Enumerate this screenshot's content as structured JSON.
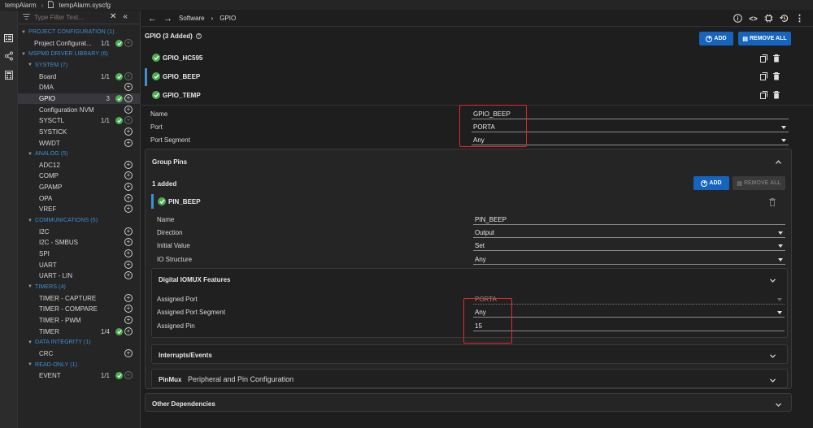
{
  "titlebar": {
    "project": "tempAlarm",
    "file": "tempAlarm.syscfg"
  },
  "sidebar": {
    "filter_placeholder": "Type Filter Text...",
    "rows": [
      {
        "kind": "cat",
        "label": "PROJECT CONFIGURATION (1)"
      },
      {
        "kind": "item",
        "label": "Project Configurat...",
        "count": "1/1",
        "ok": true,
        "plus": "dim"
      },
      {
        "kind": "cat",
        "label": "MSPM0 DRIVER LIBRARY (6)"
      },
      {
        "kind": "cat",
        "label": "SYSTEM (7)",
        "sub": true
      },
      {
        "kind": "item",
        "label": "Board",
        "count": "1/1",
        "ok": true,
        "plus": "dim"
      },
      {
        "kind": "item",
        "label": "DMA",
        "plus": "on"
      },
      {
        "kind": "item",
        "label": "GPIO",
        "count": "3",
        "ok": true,
        "plus": "on",
        "selected": true
      },
      {
        "kind": "item",
        "label": "Configuration NVM",
        "plus": "on"
      },
      {
        "kind": "item",
        "label": "SYSCTL",
        "count": "1/1",
        "ok": true,
        "plus": "dim"
      },
      {
        "kind": "item",
        "label": "SYSTICK",
        "plus": "on"
      },
      {
        "kind": "item",
        "label": "WWDT",
        "plus": "on"
      },
      {
        "kind": "cat",
        "label": "ANALOG (5)",
        "sub": true
      },
      {
        "kind": "item",
        "label": "ADC12",
        "plus": "on"
      },
      {
        "kind": "item",
        "label": "COMP",
        "plus": "on"
      },
      {
        "kind": "item",
        "label": "GPAMP",
        "plus": "on"
      },
      {
        "kind": "item",
        "label": "OPA",
        "plus": "on"
      },
      {
        "kind": "item",
        "label": "VREF",
        "plus": "on"
      },
      {
        "kind": "cat",
        "label": "COMMUNICATIONS (5)",
        "sub": true
      },
      {
        "kind": "item",
        "label": "I2C",
        "plus": "on"
      },
      {
        "kind": "item",
        "label": "I2C - SMBUS",
        "plus": "on"
      },
      {
        "kind": "item",
        "label": "SPI",
        "plus": "on"
      },
      {
        "kind": "item",
        "label": "UART",
        "plus": "on"
      },
      {
        "kind": "item",
        "label": "UART - LIN",
        "plus": "on"
      },
      {
        "kind": "cat",
        "label": "TIMERS (4)",
        "sub": true
      },
      {
        "kind": "item",
        "label": "TIMER - CAPTURE",
        "plus": "on"
      },
      {
        "kind": "item",
        "label": "TIMER - COMPARE",
        "plus": "on"
      },
      {
        "kind": "item",
        "label": "TIMER - PWM",
        "plus": "on"
      },
      {
        "kind": "item",
        "label": "TIMER",
        "count": "1/4",
        "ok": true,
        "plus": "on"
      },
      {
        "kind": "cat",
        "label": "DATA INTEGRITY (1)",
        "sub": true
      },
      {
        "kind": "item",
        "label": "CRC",
        "plus": "on"
      },
      {
        "kind": "cat",
        "label": "READ-ONLY (1)",
        "sub": true
      },
      {
        "kind": "item",
        "label": "EVENT",
        "count": "1/1",
        "ok": true,
        "plus": "dim"
      }
    ]
  },
  "topbar": {
    "crumb_software": "Software",
    "crumb_gpio": "GPIO"
  },
  "main": {
    "header": "GPIO (3 Added)",
    "add_label": "ADD",
    "remove_all_label": "REMOVE ALL",
    "instances": [
      "GPIO_HC595",
      "GPIO_BEEP",
      "GPIO_TEMP"
    ],
    "props": {
      "name_label": "Name",
      "name_value": "GPIO_BEEP",
      "port_label": "Port",
      "port_value": "PORTA",
      "seg_label": "Port Segment",
      "seg_value": "Any"
    },
    "group_pins": {
      "title": "Group Pins",
      "added": "1 added",
      "add_label": "ADD",
      "remove_all_label": "REMOVE ALL",
      "pin_name": "PIN_BEEP",
      "props": {
        "name_label": "Name",
        "name_value": "PIN_BEEP",
        "dir_label": "Direction",
        "dir_value": "Output",
        "init_label": "Initial Value",
        "init_value": "Set",
        "io_label": "IO Structure",
        "io_value": "Any"
      },
      "iomux": {
        "title": "Digital IOMUX Features",
        "port_label": "Assigned Port",
        "port_value": "PORTA",
        "seg_label": "Assigned Port Segment",
        "seg_value": "Any",
        "pin_label": "Assigned Pin",
        "pin_value": "15"
      },
      "interrupts_title": "Interrupts/Events",
      "pinmux_title": "PinMux",
      "pinmux_sub": "Peripheral and Pin Configuration"
    },
    "other_deps": "Other Dependencies"
  },
  "colors": {
    "accent": "#1565c0",
    "ok": "#4caf50",
    "highlight": "#e0282a",
    "category": "#3d8fd6"
  }
}
